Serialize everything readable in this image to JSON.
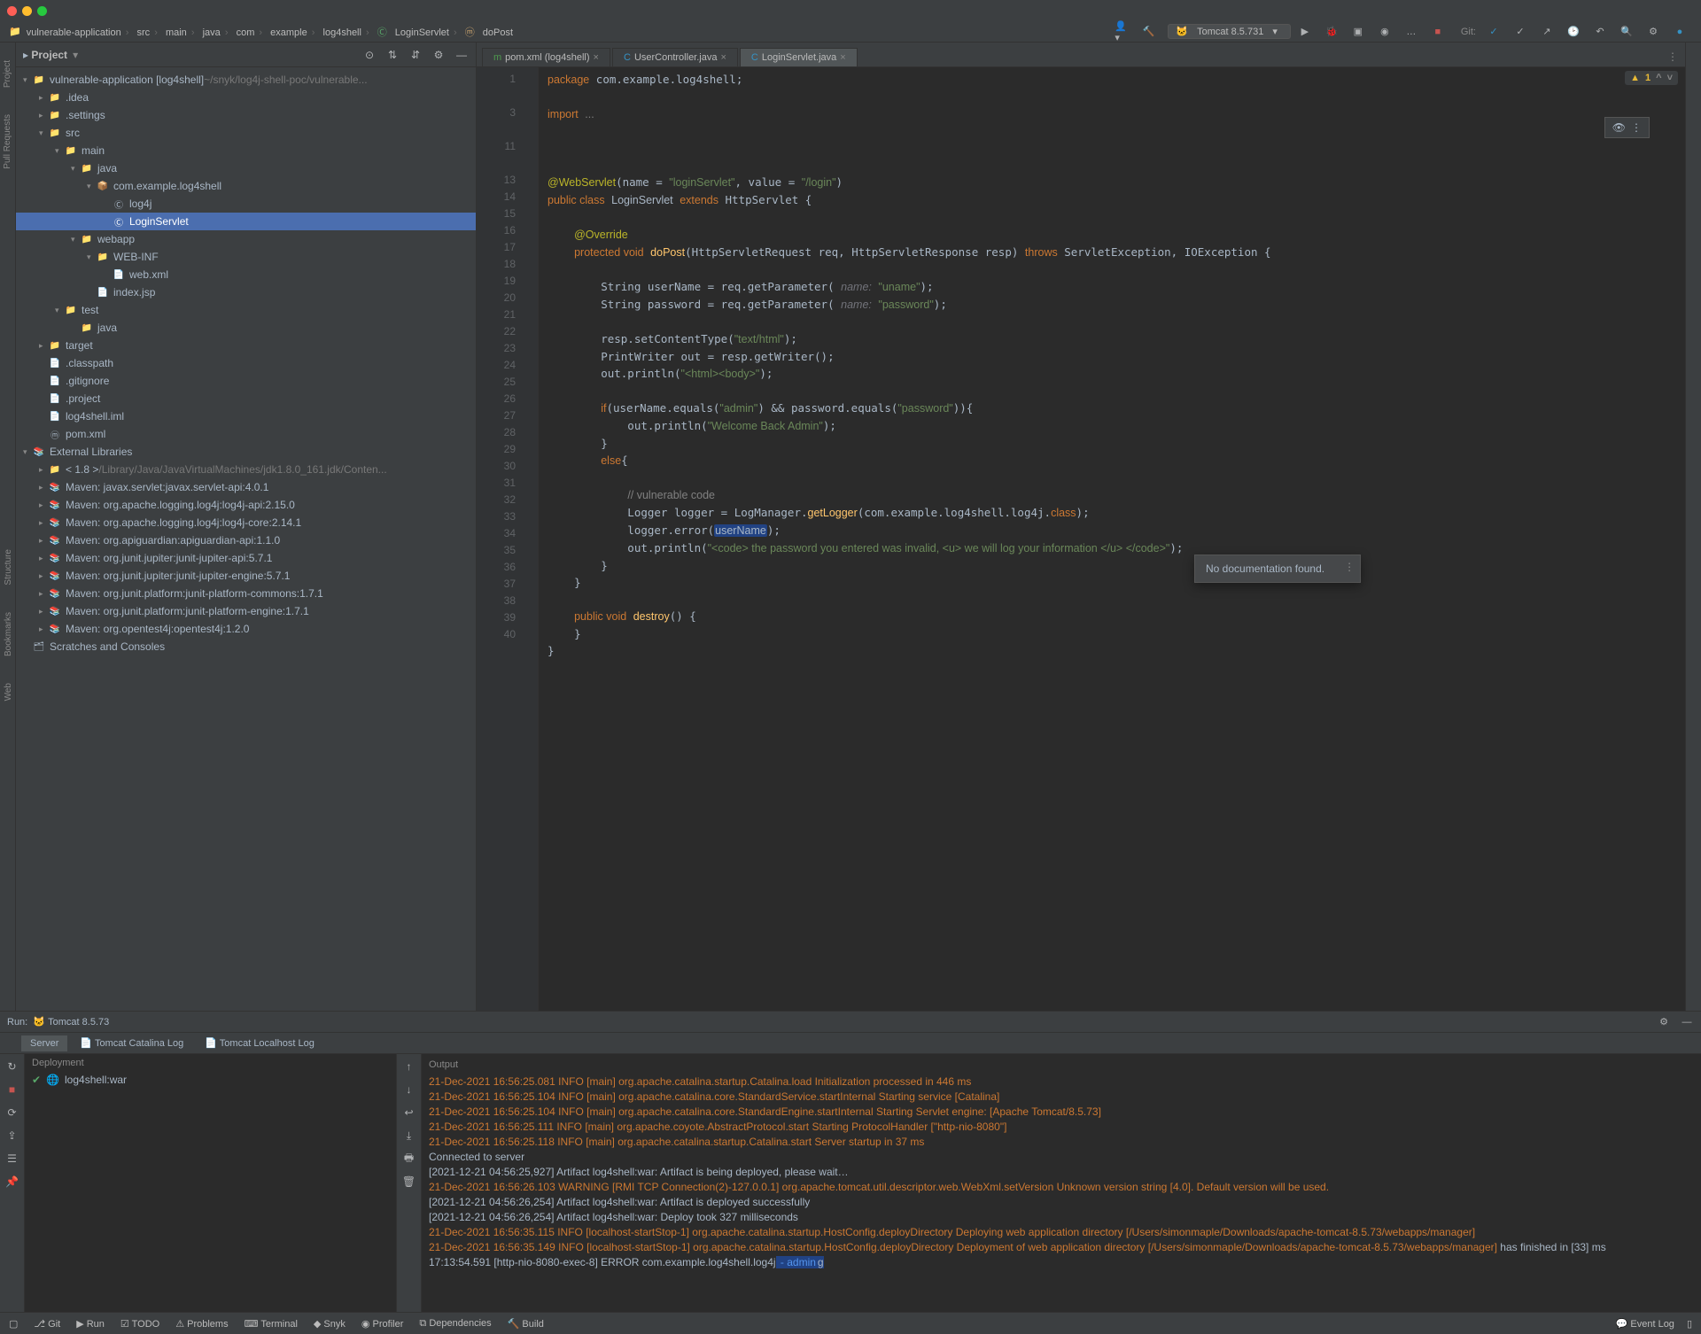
{
  "breadcrumb": [
    "vulnerable-application",
    "src",
    "main",
    "java",
    "com",
    "example",
    "log4shell",
    "LoginServlet",
    "doPost"
  ],
  "runconfig": "Tomcat 8.5.731",
  "project_header": {
    "title": "Project"
  },
  "tree": [
    {
      "d": 0,
      "open": true,
      "icon": "📁",
      "label": "vulnerable-application [log4shell]",
      "suffix": " ~/snyk/log4j-shell-poc/vulnerable..."
    },
    {
      "d": 1,
      "open": false,
      "icon": "📁",
      "label": ".idea"
    },
    {
      "d": 1,
      "open": false,
      "icon": "📁",
      "label": ".settings"
    },
    {
      "d": 1,
      "open": true,
      "icon": "📁",
      "label": "src"
    },
    {
      "d": 2,
      "open": true,
      "icon": "📁",
      "label": "main"
    },
    {
      "d": 3,
      "open": true,
      "icon": "📁",
      "label": "java",
      "blue": true
    },
    {
      "d": 4,
      "open": true,
      "icon": "📦",
      "label": "com.example.log4shell"
    },
    {
      "d": 5,
      "icon": "Ⓒ",
      "label": "log4j"
    },
    {
      "d": 5,
      "icon": "Ⓒ",
      "label": "LoginServlet",
      "selected": true
    },
    {
      "d": 3,
      "open": true,
      "icon": "📁",
      "label": "webapp"
    },
    {
      "d": 4,
      "open": true,
      "icon": "📁",
      "label": "WEB-INF"
    },
    {
      "d": 5,
      "icon": "📄",
      "label": "web.xml"
    },
    {
      "d": 4,
      "icon": "📄",
      "label": "index.jsp"
    },
    {
      "d": 2,
      "open": true,
      "icon": "📁",
      "label": "test"
    },
    {
      "d": 3,
      "icon": "📁",
      "label": "java",
      "blue": true
    },
    {
      "d": 1,
      "open": false,
      "icon": "📁",
      "label": "target",
      "orange": true
    },
    {
      "d": 1,
      "icon": "📄",
      "label": ".classpath"
    },
    {
      "d": 1,
      "icon": "📄",
      "label": ".gitignore"
    },
    {
      "d": 1,
      "icon": "📄",
      "label": ".project"
    },
    {
      "d": 1,
      "icon": "📄",
      "label": "log4shell.iml"
    },
    {
      "d": 1,
      "icon": "ⓜ",
      "label": "pom.xml"
    },
    {
      "d": 0,
      "open": true,
      "icon": "📚",
      "label": "External Libraries"
    },
    {
      "d": 1,
      "open": false,
      "icon": "📁",
      "label": "< 1.8 >",
      "suffix": " /Library/Java/JavaVirtualMachines/jdk1.8.0_161.jdk/Conten..."
    },
    {
      "d": 1,
      "open": false,
      "icon": "📚",
      "label": "Maven: javax.servlet:javax.servlet-api:4.0.1"
    },
    {
      "d": 1,
      "open": false,
      "icon": "📚",
      "label": "Maven: org.apache.logging.log4j:log4j-api:2.15.0"
    },
    {
      "d": 1,
      "open": false,
      "icon": "📚",
      "label": "Maven: org.apache.logging.log4j:log4j-core:2.14.1"
    },
    {
      "d": 1,
      "open": false,
      "icon": "📚",
      "label": "Maven: org.apiguardian:apiguardian-api:1.1.0"
    },
    {
      "d": 1,
      "open": false,
      "icon": "📚",
      "label": "Maven: org.junit.jupiter:junit-jupiter-api:5.7.1"
    },
    {
      "d": 1,
      "open": false,
      "icon": "📚",
      "label": "Maven: org.junit.jupiter:junit-jupiter-engine:5.7.1"
    },
    {
      "d": 1,
      "open": false,
      "icon": "📚",
      "label": "Maven: org.junit.platform:junit-platform-commons:1.7.1"
    },
    {
      "d": 1,
      "open": false,
      "icon": "📚",
      "label": "Maven: org.junit.platform:junit-platform-engine:1.7.1"
    },
    {
      "d": 1,
      "open": false,
      "icon": "📚",
      "label": "Maven: org.opentest4j:opentest4j:1.2.0"
    },
    {
      "d": 0,
      "icon": "🗂",
      "label": "Scratches and Consoles"
    }
  ],
  "tabs": [
    {
      "label": "pom.xml (log4shell)",
      "active": false,
      "icon": "m"
    },
    {
      "label": "UserController.java",
      "active": false,
      "icon": "C"
    },
    {
      "label": "LoginServlet.java",
      "active": true,
      "icon": "C"
    }
  ],
  "line_numbers": [
    1,
    "",
    3,
    "",
    11,
    "",
    13,
    14,
    15,
    16,
    17,
    18,
    19,
    20,
    21,
    22,
    23,
    24,
    25,
    26,
    27,
    28,
    29,
    30,
    31,
    32,
    33,
    34,
    35,
    36,
    37,
    38,
    39,
    40
  ],
  "errcount": "1",
  "doc_popup": "No documentation found.",
  "run": {
    "label": "Run:",
    "config": "Tomcat 8.5.73",
    "tabs": [
      "Server",
      "Tomcat Catalina Log",
      "Tomcat Localhost Log"
    ],
    "deploy_header": "Deployment",
    "deploy_item": "log4shell:war",
    "output_label": "Output",
    "log": [
      {
        "cls": "info",
        "text": "21-Dec-2021 16:56:25.081 INFO [main] org.apache.catalina.startup.Catalina.load Initialization processed in 446 ms"
      },
      {
        "cls": "info",
        "text": "21-Dec-2021 16:56:25.104 INFO [main] org.apache.catalina.core.StandardService.startInternal Starting service [Catalina]"
      },
      {
        "cls": "info",
        "text": "21-Dec-2021 16:56:25.104 INFO [main] org.apache.catalina.core.StandardEngine.startInternal Starting Servlet engine: [Apache Tomcat/8.5.73]"
      },
      {
        "cls": "info",
        "text": "21-Dec-2021 16:56:25.111 INFO [main] org.apache.coyote.AbstractProtocol.start Starting ProtocolHandler [\"http-nio-8080\"]"
      },
      {
        "cls": "info",
        "text": "21-Dec-2021 16:56:25.118 INFO [main] org.apache.catalina.startup.Catalina.start Server startup in 37 ms"
      },
      {
        "cls": "plain",
        "text": "Connected to server"
      },
      {
        "cls": "plain",
        "text": "[2021-12-21 04:56:25,927] Artifact log4shell:war: Artifact is being deployed, please wait…"
      },
      {
        "cls": "warn",
        "text": "21-Dec-2021 16:56:26.103 WARNING [RMI TCP Connection(2)-127.0.0.1] org.apache.tomcat.util.descriptor.web.WebXml.setVersion Unknown version string [4.0]. Default version will be used."
      },
      {
        "cls": "plain",
        "text": "[2021-12-21 04:56:26,254] Artifact log4shell:war: Artifact is deployed successfully"
      },
      {
        "cls": "plain",
        "text": "[2021-12-21 04:56:26,254] Artifact log4shell:war: Deploy took 327 milliseconds"
      },
      {
        "cls": "info",
        "text": "21-Dec-2021 16:56:35.115 INFO [localhost-startStop-1] org.apache.catalina.startup.HostConfig.deployDirectory Deploying web application directory [/Users/simonmaple/Downloads/apache-tomcat-8.5.73/webapps/manager]"
      },
      {
        "cls": "info",
        "text": "21-Dec-2021 16:56:35.149 INFO [localhost-startStop-1] org.apache.catalina.startup.HostConfig.deployDirectory Deployment of web application directory [/Users/simonmaple/Downloads/apache-tomcat-8.5.73/webapps/manager]",
        "tail_plain": " has finished in [33] ms"
      }
    ],
    "final_line_prefix": "17:13:54.591 [http-nio-8080-exec-8] ERROR com.example.log4shell.log4j",
    "final_line_hl": " - admin"
  },
  "status": {
    "left": [
      "Git",
      "Run",
      "TODO",
      "Problems",
      "Terminal",
      "Snyk",
      "Profiler",
      "Dependencies",
      "Build"
    ],
    "right": [
      "Event Log"
    ]
  },
  "left_sidebar": [
    "Project",
    "Pull Requests"
  ],
  "left_sidebar2": [
    "Structure",
    "Bookmarks",
    "Web"
  ]
}
